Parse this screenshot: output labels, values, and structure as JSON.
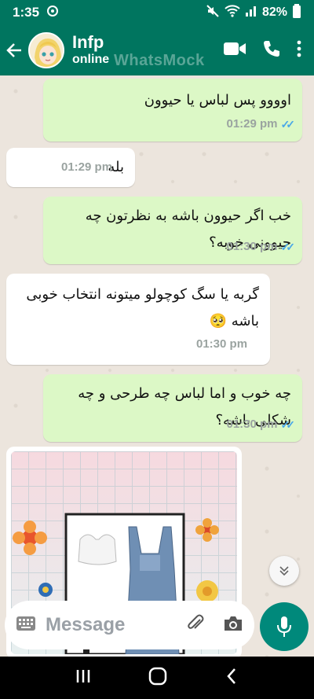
{
  "status_bar": {
    "time": "1:35",
    "battery": "82%"
  },
  "header": {
    "name": "Infp",
    "status": "online",
    "watermark": "WhatsMock"
  },
  "messages": [
    {
      "text": "اوووو پس لباس یا حیوون",
      "time": "01:29 pm",
      "direction": "outgoing",
      "read": true
    },
    {
      "text": "بله",
      "time": "01:29 pm",
      "direction": "incoming"
    },
    {
      "text": "خب اگر حیوون باشه به نظرتون چه حیوونی خوبه؟",
      "time": "01:30 pm",
      "direction": "outgoing",
      "read": true
    },
    {
      "text": "گربه یا سگ کوچولو میتونه انتخاب خوبی باشه 🥺",
      "time": "01:30 pm",
      "direction": "incoming"
    },
    {
      "text": "چه خوب و اما لباس چه طرحی و چه شکلی باشه؟",
      "time": "01:30 pm",
      "direction": "outgoing",
      "read": true
    }
  ],
  "composer": {
    "placeholder": "Message"
  },
  "colors": {
    "header": "#00755f",
    "outgoing_bubble": "#dcf8c6",
    "incoming_bubble": "#ffffff",
    "read_ticks": "#4aa8e8",
    "mic_button": "#00897b"
  }
}
